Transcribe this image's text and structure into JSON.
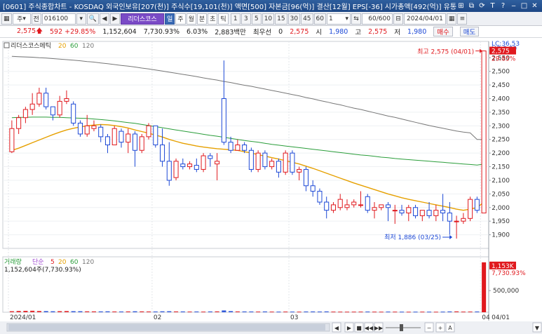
{
  "window": {
    "title": "[0601] 주식종합차트 - KOSDAQ 외국인보유[207(천)] 주식수[19,101(천)] 액면[500] 자본금[96(억)] 결산[12월] EPS[-36] 시가총액[492(억)] 유통비율["
  },
  "toolbar": {
    "mode": "주",
    "code_label": "전",
    "code": "016100",
    "stock_name": "리더스코스",
    "periods": [
      "일",
      "주",
      "월",
      "분",
      "초",
      "틱"
    ],
    "active_period": "일",
    "intervals": [
      "1",
      "3",
      "5",
      "10",
      "15",
      "30",
      "45",
      "60"
    ],
    "count_select": "1",
    "display_count": "60/600",
    "date": "2024/04/01"
  },
  "info": {
    "price": "2,575",
    "change": "592 +29.85%",
    "volume": "1,152,604",
    "volume_ratio": "7,730.93%",
    "turnover": "6.03%",
    "amount": "2,883백만",
    "pref_label": "최우선",
    "pref_value": "0",
    "ask": "2,575",
    "open_label": "시",
    "open": "1,980",
    "high_label": "고",
    "high": "2,575",
    "low_label": "저",
    "low": "1,980",
    "buy_btn": "매수",
    "sell_btn": "매도"
  },
  "chart_data": [
    {
      "type": "candlestick",
      "legend": {
        "name": "리더스코스메틱",
        "ma": [
          "20",
          "60",
          "120"
        ]
      },
      "colors": {
        "up": "#e0191e",
        "down": "#1d49d6",
        "ma20": "#e6a000",
        "ma60": "#2a9d3a",
        "ma120": "#777777"
      },
      "ylim": [
        1850,
        2610
      ],
      "y_ticks": [
        1900,
        1950,
        2000,
        2050,
        2100,
        2150,
        2200,
        2250,
        2300,
        2350,
        2400,
        2450,
        2500,
        2550
      ],
      "y_tick_labels": [
        "1,900",
        "1,950",
        "2,000",
        "2,050",
        "2,100",
        "2,150",
        "2,200",
        "2,250",
        "2,300",
        "2,350",
        "2,400",
        "2,450",
        "2,500",
        "2,550"
      ],
      "right_labels": {
        "lc": "LC:36.53",
        "hc": "HC:0.00",
        "current": "2,575",
        "pct": "29.85%"
      },
      "annotations": {
        "high": "최고 2,575 (04/01)",
        "low": "최저 1,886 (03/25)"
      },
      "candles": [
        [
          2205,
          2320,
          2200,
          2290
        ],
        [
          2290,
          2340,
          2270,
          2330
        ],
        [
          2330,
          2370,
          2310,
          2360
        ],
        [
          2360,
          2420,
          2340,
          2380
        ],
        [
          2380,
          2440,
          2370,
          2420
        ],
        [
          2420,
          2440,
          2360,
          2370
        ],
        [
          2370,
          2370,
          2320,
          2340
        ],
        [
          2340,
          2410,
          2330,
          2390
        ],
        [
          2390,
          2430,
          2380,
          2400
        ],
        [
          2380,
          2390,
          2300,
          2310
        ],
        [
          2310,
          2320,
          2260,
          2270
        ],
        [
          2270,
          2340,
          2260,
          2300
        ],
        [
          2290,
          2320,
          2280,
          2300
        ],
        [
          2295,
          2305,
          2240,
          2260
        ],
        [
          2260,
          2270,
          2200,
          2230
        ],
        [
          2230,
          2300,
          2230,
          2290
        ],
        [
          2280,
          2290,
          2220,
          2240
        ],
        [
          2240,
          2290,
          2200,
          2270
        ],
        [
          2270,
          2280,
          2150,
          2210
        ],
        [
          2210,
          2270,
          2200,
          2260
        ],
        [
          2260,
          2310,
          2250,
          2300
        ],
        [
          2300,
          2300,
          2220,
          2230
        ],
        [
          2230,
          2290,
          2150,
          2170
        ],
        [
          2170,
          2240,
          2080,
          2100
        ],
        [
          2110,
          2180,
          2100,
          2170
        ],
        [
          2160,
          2180,
          2140,
          2150
        ],
        [
          2150,
          2170,
          2140,
          2160
        ],
        [
          2155,
          2180,
          2130,
          2140
        ],
        [
          2140,
          2200,
          2130,
          2190
        ],
        [
          2190,
          2200,
          2150,
          2180
        ],
        [
          2160,
          2200,
          2100,
          2170
        ],
        [
          2400,
          2540,
          2230,
          2240
        ],
        [
          2240,
          2260,
          2200,
          2210
        ],
        [
          2210,
          2250,
          2210,
          2230
        ],
        [
          2230,
          2240,
          2200,
          2210
        ],
        [
          2210,
          2220,
          2130,
          2140
        ],
        [
          2140,
          2210,
          2130,
          2200
        ],
        [
          2200,
          2210,
          2140,
          2150
        ],
        [
          2150,
          2180,
          2140,
          2170
        ],
        [
          2170,
          2180,
          2110,
          2130
        ],
        [
          2130,
          2210,
          2120,
          2200
        ],
        [
          2200,
          2210,
          2120,
          2130
        ],
        [
          2130,
          2150,
          2100,
          2140
        ],
        [
          2140,
          2150,
          2060,
          2080
        ],
        [
          2080,
          2100,
          2040,
          2060
        ],
        [
          2060,
          2070,
          2010,
          2020
        ],
        [
          2020,
          2040,
          1960,
          1990
        ],
        [
          1990,
          2020,
          1980,
          2010
        ],
        [
          2000,
          2050,
          1990,
          2030
        ],
        [
          2000,
          2030,
          1990,
          2010
        ],
        [
          2010,
          2030,
          2000,
          2020
        ],
        [
          2010,
          2060,
          2000,
          2010
        ],
        [
          2040,
          2050,
          1980,
          1990
        ],
        [
          1990,
          2020,
          1960,
          2000
        ],
        [
          2000,
          2010,
          1990,
          2010
        ],
        [
          2010,
          2020,
          1950,
          2000
        ],
        [
          1990,
          2010,
          1940,
          1990
        ],
        [
          1990,
          2010,
          1970,
          1980
        ],
        [
          1980,
          2010,
          1950,
          2000
        ],
        [
          2000,
          2010,
          1960,
          1970
        ],
        [
          1970,
          1990,
          1950,
          1990
        ],
        [
          1990,
          2020,
          1960,
          1970
        ],
        [
          1970,
          2010,
          1950,
          1990
        ],
        [
          1990,
          2050,
          1950,
          1980
        ],
        [
          1980,
          2020,
          1900,
          1950
        ],
        [
          1950,
          1970,
          1886,
          1950
        ],
        [
          1950,
          1980,
          1940,
          1960
        ],
        [
          1960,
          2040,
          1950,
          2030
        ],
        [
          2030,
          2040,
          1980,
          1990
        ],
        [
          1980,
          2575,
          1980,
          2575
        ]
      ],
      "ma20": [
        2210,
        2218,
        2228,
        2238,
        2248,
        2258,
        2268,
        2277,
        2285,
        2291,
        2296,
        2300,
        2303,
        2305,
        2304,
        2301,
        2297,
        2292,
        2285,
        2279,
        2273,
        2266,
        2259,
        2250,
        2243,
        2236,
        2231,
        2226,
        2222,
        2219,
        2216,
        2214,
        2212,
        2210,
        2205,
        2200,
        2194,
        2189,
        2183,
        2178,
        2172,
        2166,
        2160,
        2152,
        2144,
        2135,
        2126,
        2117,
        2108,
        2099,
        2090,
        2082,
        2074,
        2066,
        2058,
        2050,
        2043,
        2036,
        2030,
        2025,
        2020,
        2015,
        2010,
        2005,
        2000,
        1994,
        1990,
        1994,
        2000,
        2020
      ],
      "ma60": [
        2330,
        2331,
        2331,
        2332,
        2332,
        2332,
        2331,
        2331,
        2330,
        2329,
        2328,
        2327,
        2325,
        2323,
        2321,
        2318,
        2315,
        2312,
        2309,
        2305,
        2301,
        2297,
        2293,
        2289,
        2285,
        2281,
        2277,
        2273,
        2269,
        2265,
        2262,
        2258,
        2254,
        2250,
        2246,
        2243,
        2240,
        2236,
        2232,
        2229,
        2226,
        2223,
        2220,
        2217,
        2214,
        2211,
        2208,
        2205,
        2202,
        2199,
        2196,
        2193,
        2191,
        2188,
        2185,
        2183,
        2180,
        2178,
        2176,
        2174,
        2172,
        2170,
        2168,
        2166,
        2164,
        2162,
        2160,
        2158,
        2156,
        2160
      ],
      "ma120": [
        2555,
        2554,
        2553,
        2552,
        2550,
        2549,
        2547,
        2545,
        2543,
        2541,
        2539,
        2536,
        2534,
        2531,
        2528,
        2525,
        2522,
        2519,
        2516,
        2512,
        2509,
        2505,
        2501,
        2497,
        2493,
        2489,
        2485,
        2481,
        2476,
        2472,
        2468,
        2463,
        2459,
        2454,
        2449,
        2445,
        2440,
        2435,
        2430,
        2425,
        2420,
        2415,
        2410,
        2404,
        2399,
        2393,
        2388,
        2382,
        2377,
        2371,
        2365,
        2360,
        2354,
        2348,
        2342,
        2336,
        2331,
        2325,
        2319,
        2313,
        2307,
        2301,
        2296,
        2291,
        2286,
        2281,
        2277,
        2274,
        2250,
        2250
      ]
    },
    {
      "type": "bar",
      "legend": {
        "name": "거래량",
        "kind": "단순",
        "periods": [
          "5",
          "20",
          "60",
          "120"
        ]
      },
      "summary": "1,152,604주(7,730.93%)",
      "y_tick": "500,000",
      "y_tick_value": 500000,
      "right_labels": {
        "current": "1,153K",
        "pct": "7,730.93%"
      },
      "ylim": [
        0,
        1280000
      ],
      "values": [
        24000,
        30000,
        33000,
        35000,
        29000,
        26000,
        22000,
        25000,
        28000,
        24000,
        23000,
        21000,
        20000,
        19000,
        21000,
        18000,
        17000,
        19000,
        22000,
        20000,
        18000,
        17000,
        21000,
        23000,
        19000,
        18000,
        16000,
        17000,
        15000,
        18000,
        20000,
        42000,
        26000,
        19000,
        18000,
        17000,
        16000,
        18000,
        15000,
        14000,
        16000,
        15000,
        14000,
        17000,
        18000,
        16000,
        19000,
        15000,
        14000,
        13000,
        14000,
        15000,
        16000,
        14000,
        13000,
        15000,
        14000,
        13000,
        12000,
        13000,
        14000,
        13000,
        12000,
        14000,
        18000,
        20000,
        15000,
        16000,
        17000,
        1152604
      ]
    }
  ],
  "time_axis": {
    "labels": [
      "2024/01",
      "02",
      "03",
      "04"
    ],
    "right_label": "04/01"
  },
  "bottom_controls": [
    "◀",
    "▶",
    "■",
    "◀◀",
    "▶▶",
    "−",
    "+",
    "A",
    "▼"
  ]
}
